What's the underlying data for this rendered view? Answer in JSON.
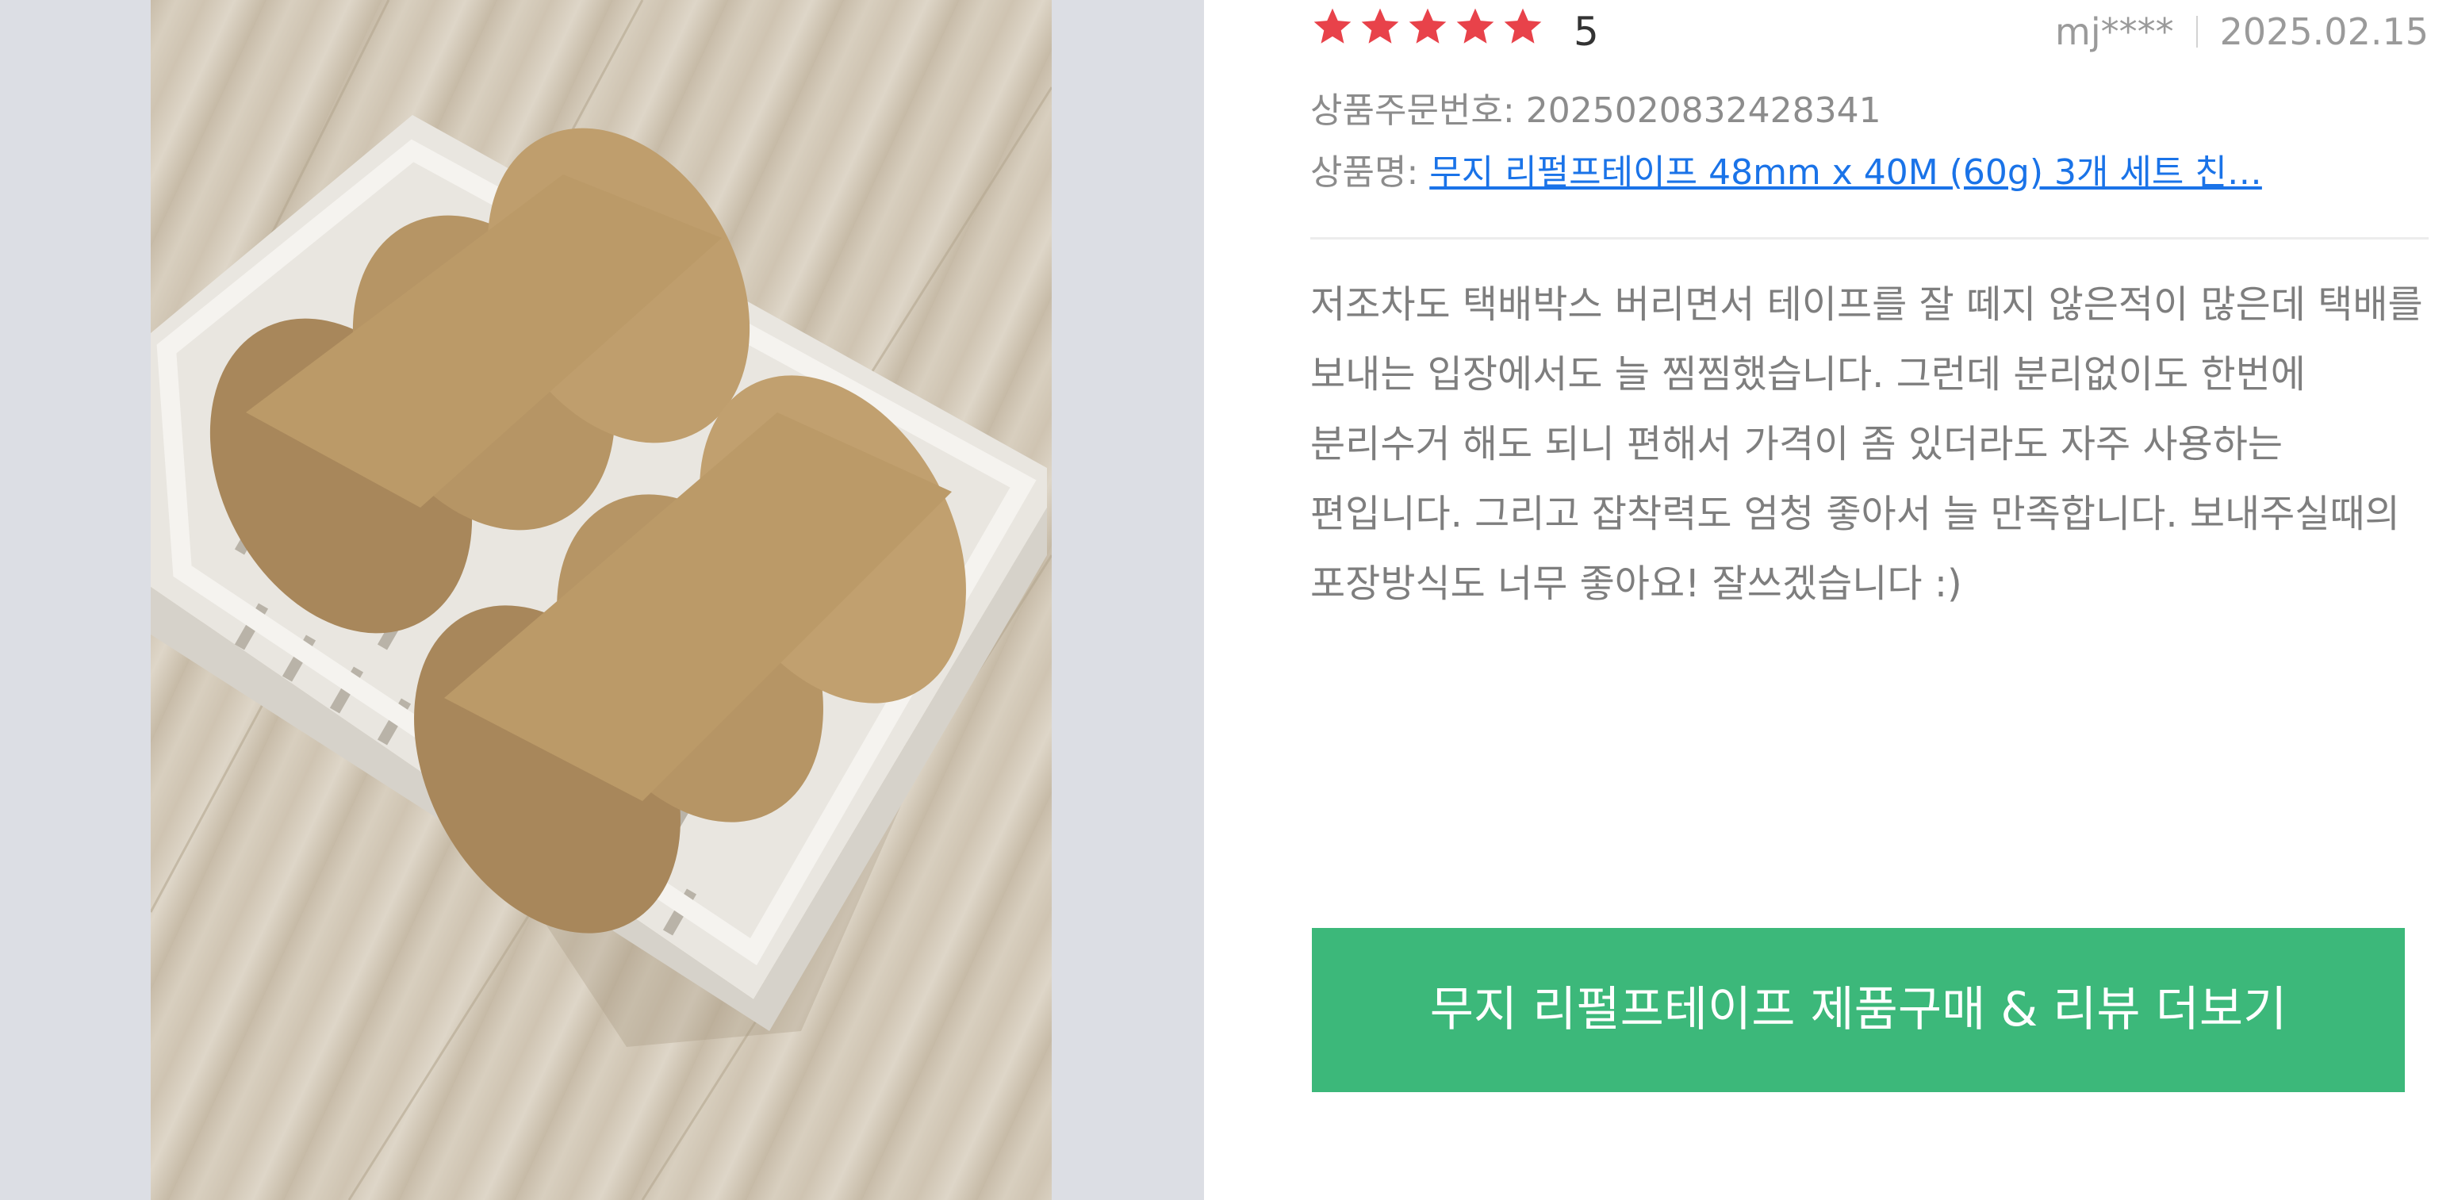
{
  "review": {
    "rating": {
      "star_count": 5,
      "score_label": "5",
      "star_color": "#e8424a"
    },
    "author": "mj****",
    "date": "2025.02.15",
    "order_label": "상품주문번호:",
    "order_number": "2025020832428341",
    "product_label": "상품명:",
    "product_name": "무지 리펄프테이프 48mm x 40M (60g) 3개 세트 친…",
    "body": "저조차도 택배박스 버리면서 테이프를 잘 떼지 않은적이 많은데 택배를 보내는 입장에서도 늘 찜찜했습니다. 그런데 분리없이도 한번에 분리수거 해도 되니 편해서 가격이 좀 있더라도 자주 사용하는 편입니다. 그리고 잡착력도 엄청 좋아서 늘 만족합니다. 보내주실때의 포장방식도 너무 좋아요! 잘쓰겠습니다 :)"
  },
  "cta": {
    "label": "무지 리펄프테이프 제품구매 & 리뷰 더보기",
    "color": "#3cb87a"
  },
  "photo": {
    "icon": "review-photo",
    "subject": "kraft paper tape rolls in a white plastic crate"
  }
}
